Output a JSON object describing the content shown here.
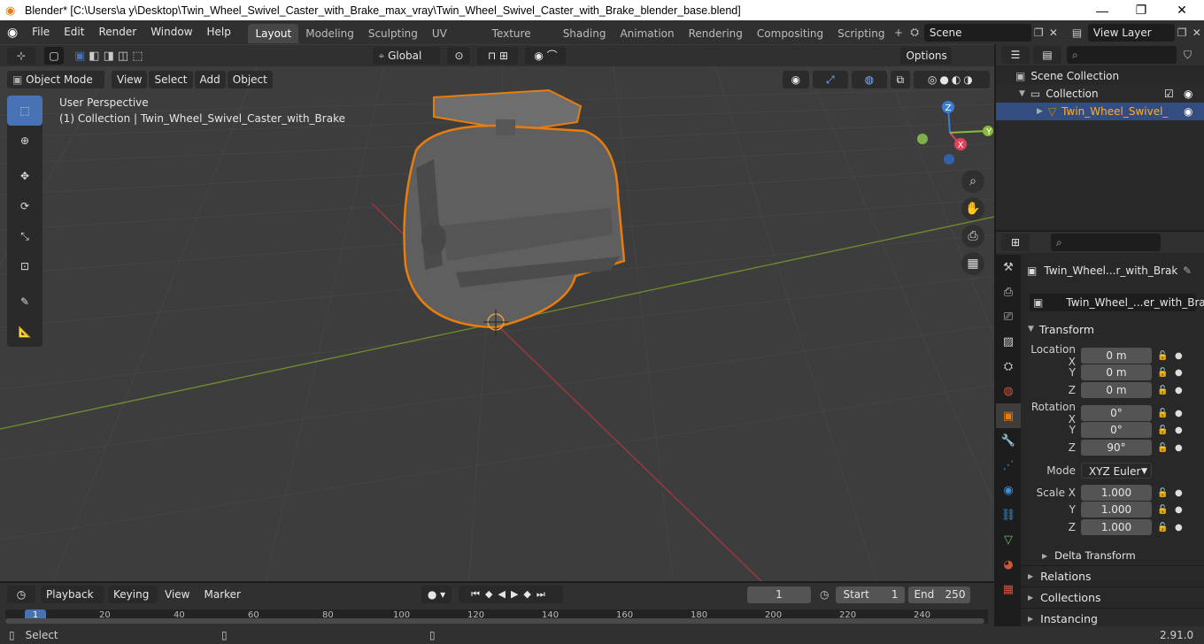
{
  "window": {
    "title": "Blender* [C:\\Users\\a y\\Desktop\\Twin_Wheel_Swivel_Caster_with_Brake_max_vray\\Twin_Wheel_Swivel_Caster_with_Brake_blender_base.blend]",
    "controls": [
      "—",
      "❐",
      "✕"
    ]
  },
  "menu": [
    "File",
    "Edit",
    "Render",
    "Window",
    "Help"
  ],
  "workspaces": [
    "Layout",
    "Modeling",
    "Sculpting",
    "UV Editing",
    "Texture Paint",
    "Shading",
    "Animation",
    "Rendering",
    "Compositing",
    "Scripting"
  ],
  "active_workspace": "Layout",
  "scene": "Scene",
  "view_layer": "View Layer",
  "tool_header": {
    "orientation": "Global",
    "options": "Options"
  },
  "viewport_header": {
    "mode": "Object Mode",
    "menus": [
      "View",
      "Select",
      "Add",
      "Object"
    ]
  },
  "viewport": {
    "info_line1": "User Perspective",
    "info_line2": "(1) Collection | Twin_Wheel_Swivel_Caster_with_Brake",
    "gizmo_labels": {
      "z": "Z",
      "y": "Y",
      "x": "X"
    }
  },
  "outliner": {
    "root": "Scene Collection",
    "collection": "Collection",
    "object": "Twin_Wheel_Swivel_"
  },
  "properties": {
    "object_name": "Twin_Wheel...r_with_Brak",
    "data_name": "Twin_Wheel_...er_with_Brake",
    "transform_header": "Transform",
    "location": {
      "label": "Location X",
      "x": "0 m",
      "y": "0 m",
      "z": "0 m"
    },
    "rotation": {
      "label": "Rotation X",
      "x": "0°",
      "y": "0°",
      "z": "90°"
    },
    "mode_label": "Mode",
    "mode": "XYZ Euler",
    "scale": {
      "label": "Scale X",
      "x": "1.000",
      "y": "1.000",
      "z": "1.000"
    },
    "axis_y": "Y",
    "axis_z": "Z",
    "sections": [
      "Delta Transform",
      "Relations",
      "Collections",
      "Instancing"
    ]
  },
  "timeline": {
    "menus": [
      "Playback",
      "Keying",
      "View",
      "Marker"
    ],
    "current_frame": "1",
    "start_label": "Start",
    "start": "1",
    "end_label": "End",
    "end": "250",
    "ruler": [
      "1",
      "20",
      "40",
      "60",
      "80",
      "100",
      "120",
      "140",
      "160",
      "180",
      "200",
      "220",
      "240"
    ]
  },
  "status": {
    "left": "Select",
    "version": "2.91.0"
  },
  "colors": {
    "accent": "#4772b3",
    "selection": "#e87d0d",
    "x_axis": "#a0373f",
    "y_axis": "#6e8a2c",
    "viewport": "#3d3d3d"
  }
}
